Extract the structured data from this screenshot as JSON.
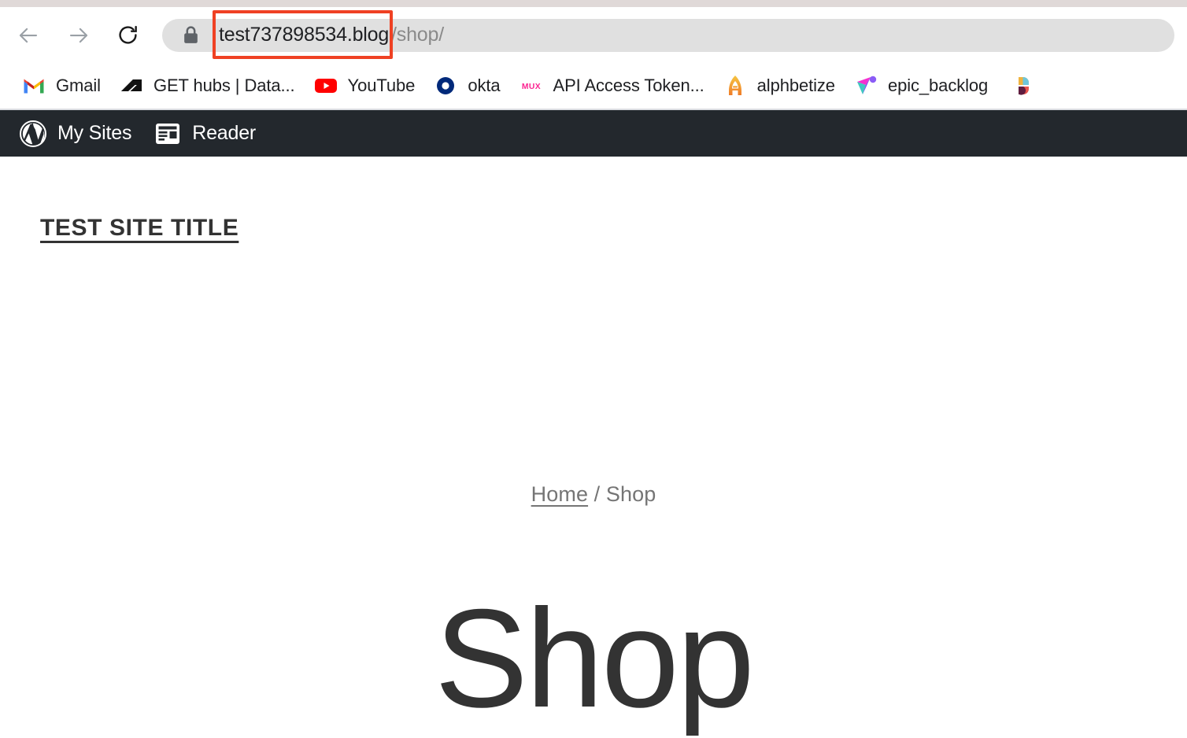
{
  "browser": {
    "nav": {
      "back_label": "Back",
      "back_icon": "arrow-left-icon",
      "forward_label": "Forward",
      "forward_icon": "arrow-right-icon",
      "reload_label": "Reload",
      "reload_icon": "reload-icon"
    },
    "omnibox": {
      "security_icon": "lock-icon",
      "url_domain": "test737898534.blog",
      "url_path": "/shop/",
      "full_url": "test737898534.blog/shop/",
      "highlight_color": "#ef4123",
      "highlighted_segment": "test737898534.blog"
    },
    "bookmarks": [
      {
        "label": "Gmail",
        "icon": "gmail-icon"
      },
      {
        "label": "GET hubs | Data...",
        "icon": "getaround-icon"
      },
      {
        "label": "YouTube",
        "icon": "youtube-icon"
      },
      {
        "label": "okta",
        "icon": "okta-icon"
      },
      {
        "label": "API Access Token...",
        "icon": "mux-icon"
      },
      {
        "label": "alphbetize",
        "icon": "rocket-a-icon"
      },
      {
        "label": "epic_backlog",
        "icon": "epic-backlog-icon"
      },
      {
        "label": "",
        "icon": "slack-quadrant-icon"
      }
    ]
  },
  "adminbar": {
    "background": "#23282d",
    "items": [
      {
        "label": "My Sites",
        "icon": "wordpress-logo-icon"
      },
      {
        "label": "Reader",
        "icon": "reader-icon"
      }
    ]
  },
  "page": {
    "site_title": "TEST SITE TITLE",
    "breadcrumb": {
      "home": "Home",
      "separator": "/",
      "current": "Shop"
    },
    "heading": "Shop"
  }
}
